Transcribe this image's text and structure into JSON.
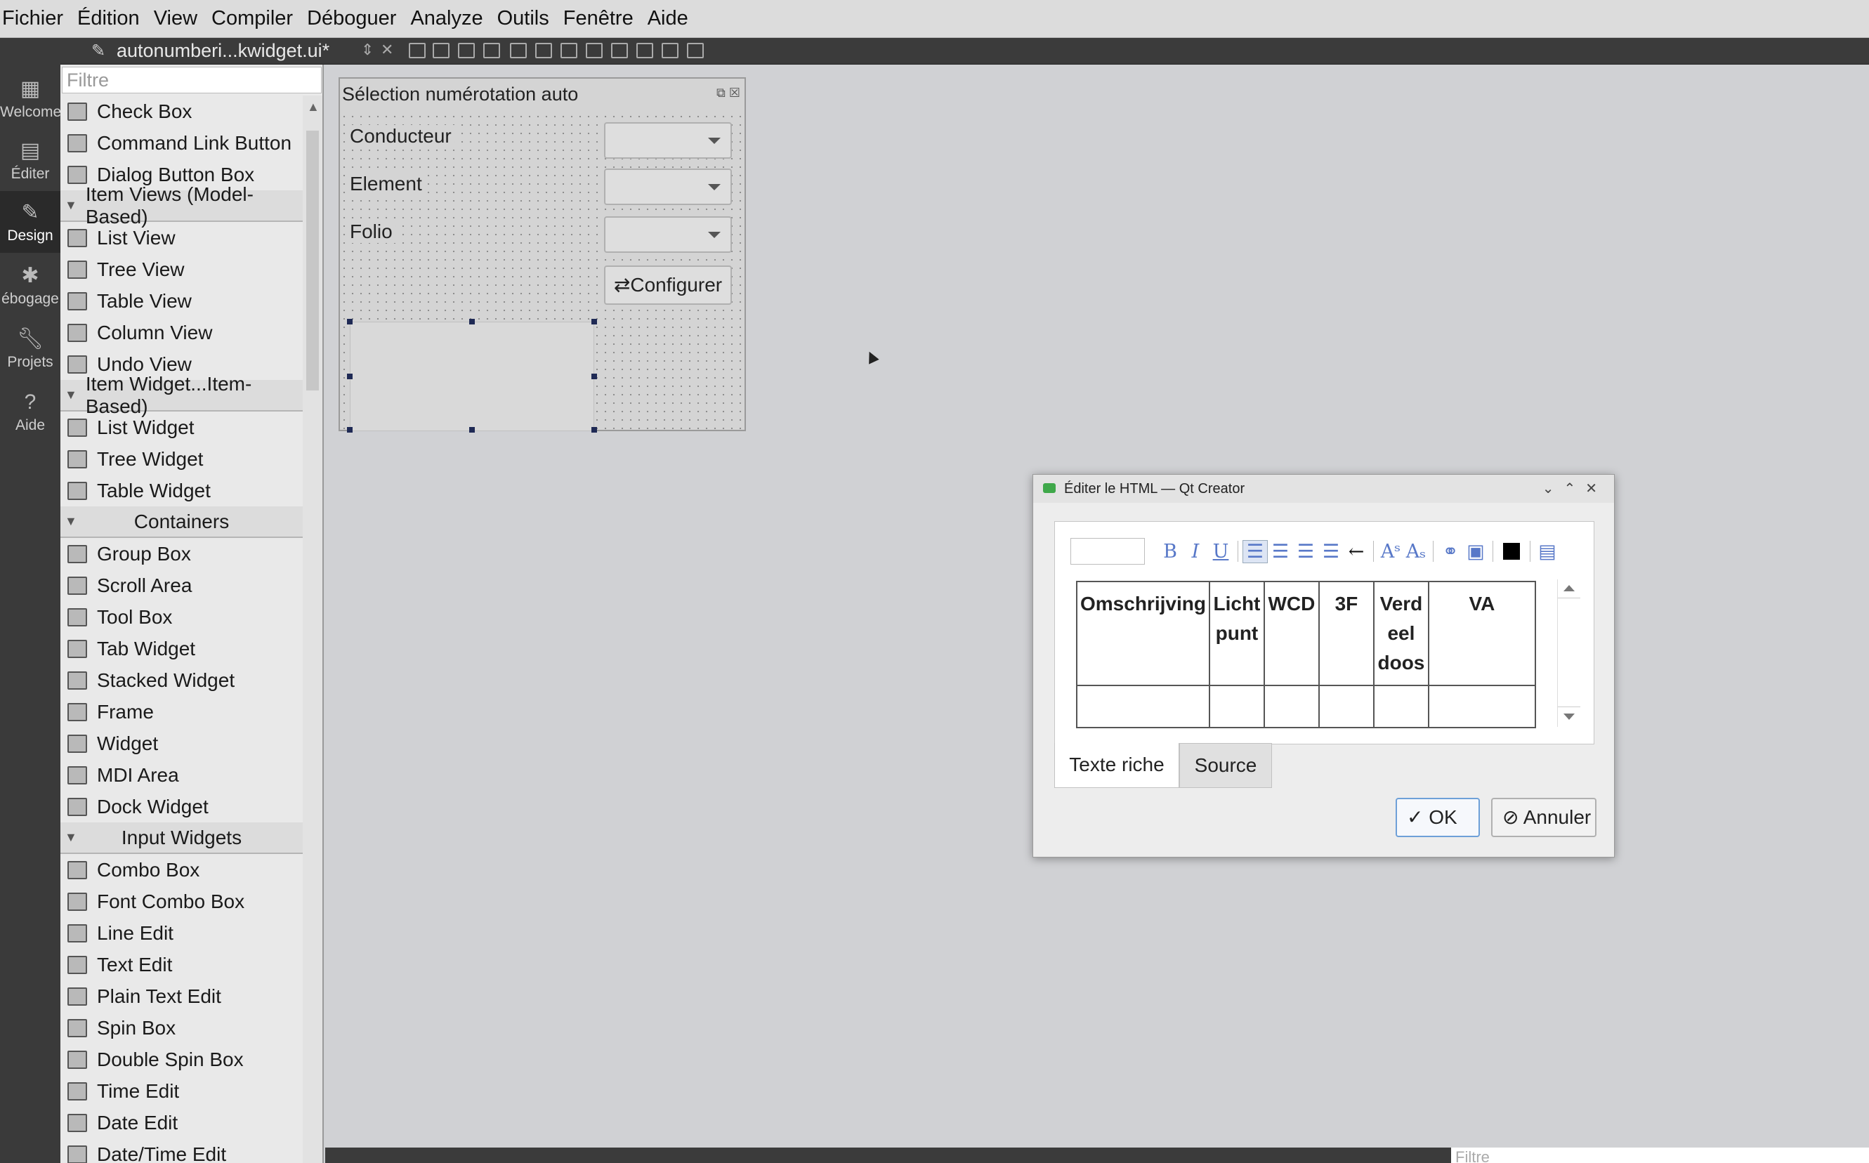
{
  "menu": [
    "Fichier",
    "Édition",
    "View",
    "Compiler",
    "Déboguer",
    "Analyze",
    "Outils",
    "Fenêtre",
    "Aide"
  ],
  "modes": [
    {
      "label": "Welcome",
      "icon": "grid-icon"
    },
    {
      "label": "Éditer",
      "icon": "document-icon"
    },
    {
      "label": "Design",
      "icon": "pencil-icon"
    },
    {
      "label": "ébogage",
      "icon": "bug-icon"
    },
    {
      "label": "Projets",
      "icon": "wrench-icon"
    },
    {
      "label": "Aide",
      "icon": "help-icon"
    }
  ],
  "editor": {
    "filename": "autonumberi...kwidget.ui*"
  },
  "widgetbox": {
    "filter_placeholder": "Filtre",
    "items": [
      {
        "type": "item",
        "label": "Check Box"
      },
      {
        "type": "item",
        "label": "Command Link Button"
      },
      {
        "type": "item",
        "label": "Dialog Button Box"
      },
      {
        "type": "category",
        "label": "Item Views (Model-Based)"
      },
      {
        "type": "item",
        "label": "List View"
      },
      {
        "type": "item",
        "label": "Tree View"
      },
      {
        "type": "item",
        "label": "Table View"
      },
      {
        "type": "item",
        "label": "Column View"
      },
      {
        "type": "item",
        "label": "Undo View"
      },
      {
        "type": "category",
        "label": "Item Widget...Item-Based)"
      },
      {
        "type": "item",
        "label": "List Widget"
      },
      {
        "type": "item",
        "label": "Tree Widget"
      },
      {
        "type": "item",
        "label": "Table Widget"
      },
      {
        "type": "category",
        "label": "Containers"
      },
      {
        "type": "item",
        "label": "Group Box"
      },
      {
        "type": "item",
        "label": "Scroll Area"
      },
      {
        "type": "item",
        "label": "Tool Box"
      },
      {
        "type": "item",
        "label": "Tab Widget"
      },
      {
        "type": "item",
        "label": "Stacked Widget"
      },
      {
        "type": "item",
        "label": "Frame"
      },
      {
        "type": "item",
        "label": "Widget"
      },
      {
        "type": "item",
        "label": "MDI Area"
      },
      {
        "type": "item",
        "label": "Dock Widget"
      },
      {
        "type": "category",
        "label": "Input Widgets"
      },
      {
        "type": "item",
        "label": "Combo Box"
      },
      {
        "type": "item",
        "label": "Font Combo Box"
      },
      {
        "type": "item",
        "label": "Line Edit"
      },
      {
        "type": "item",
        "label": "Text Edit"
      },
      {
        "type": "item",
        "label": "Plain Text Edit"
      },
      {
        "type": "item",
        "label": "Spin Box"
      },
      {
        "type": "item",
        "label": "Double Spin Box"
      },
      {
        "type": "item",
        "label": "Time Edit"
      },
      {
        "type": "item",
        "label": "Date Edit"
      },
      {
        "type": "item",
        "label": "Date/Time Edit"
      }
    ]
  },
  "form": {
    "title": "Sélection numérotation auto",
    "labels": {
      "conducteur": "Conducteur",
      "element": "Element",
      "folio": "Folio"
    },
    "configure_button": "Configurer"
  },
  "dialog": {
    "title": "Éditer le HTML — Qt Creator",
    "table_headers": [
      "Omschrijving",
      "Licht punt",
      "WCD",
      "3F",
      "Verd eel doos",
      "VA"
    ],
    "tabs": {
      "rich": "Texte riche",
      "source": "Source"
    },
    "ok": "OK",
    "cancel": "Annuler"
  },
  "bottom": {
    "filter_placeholder": "Filtre"
  }
}
